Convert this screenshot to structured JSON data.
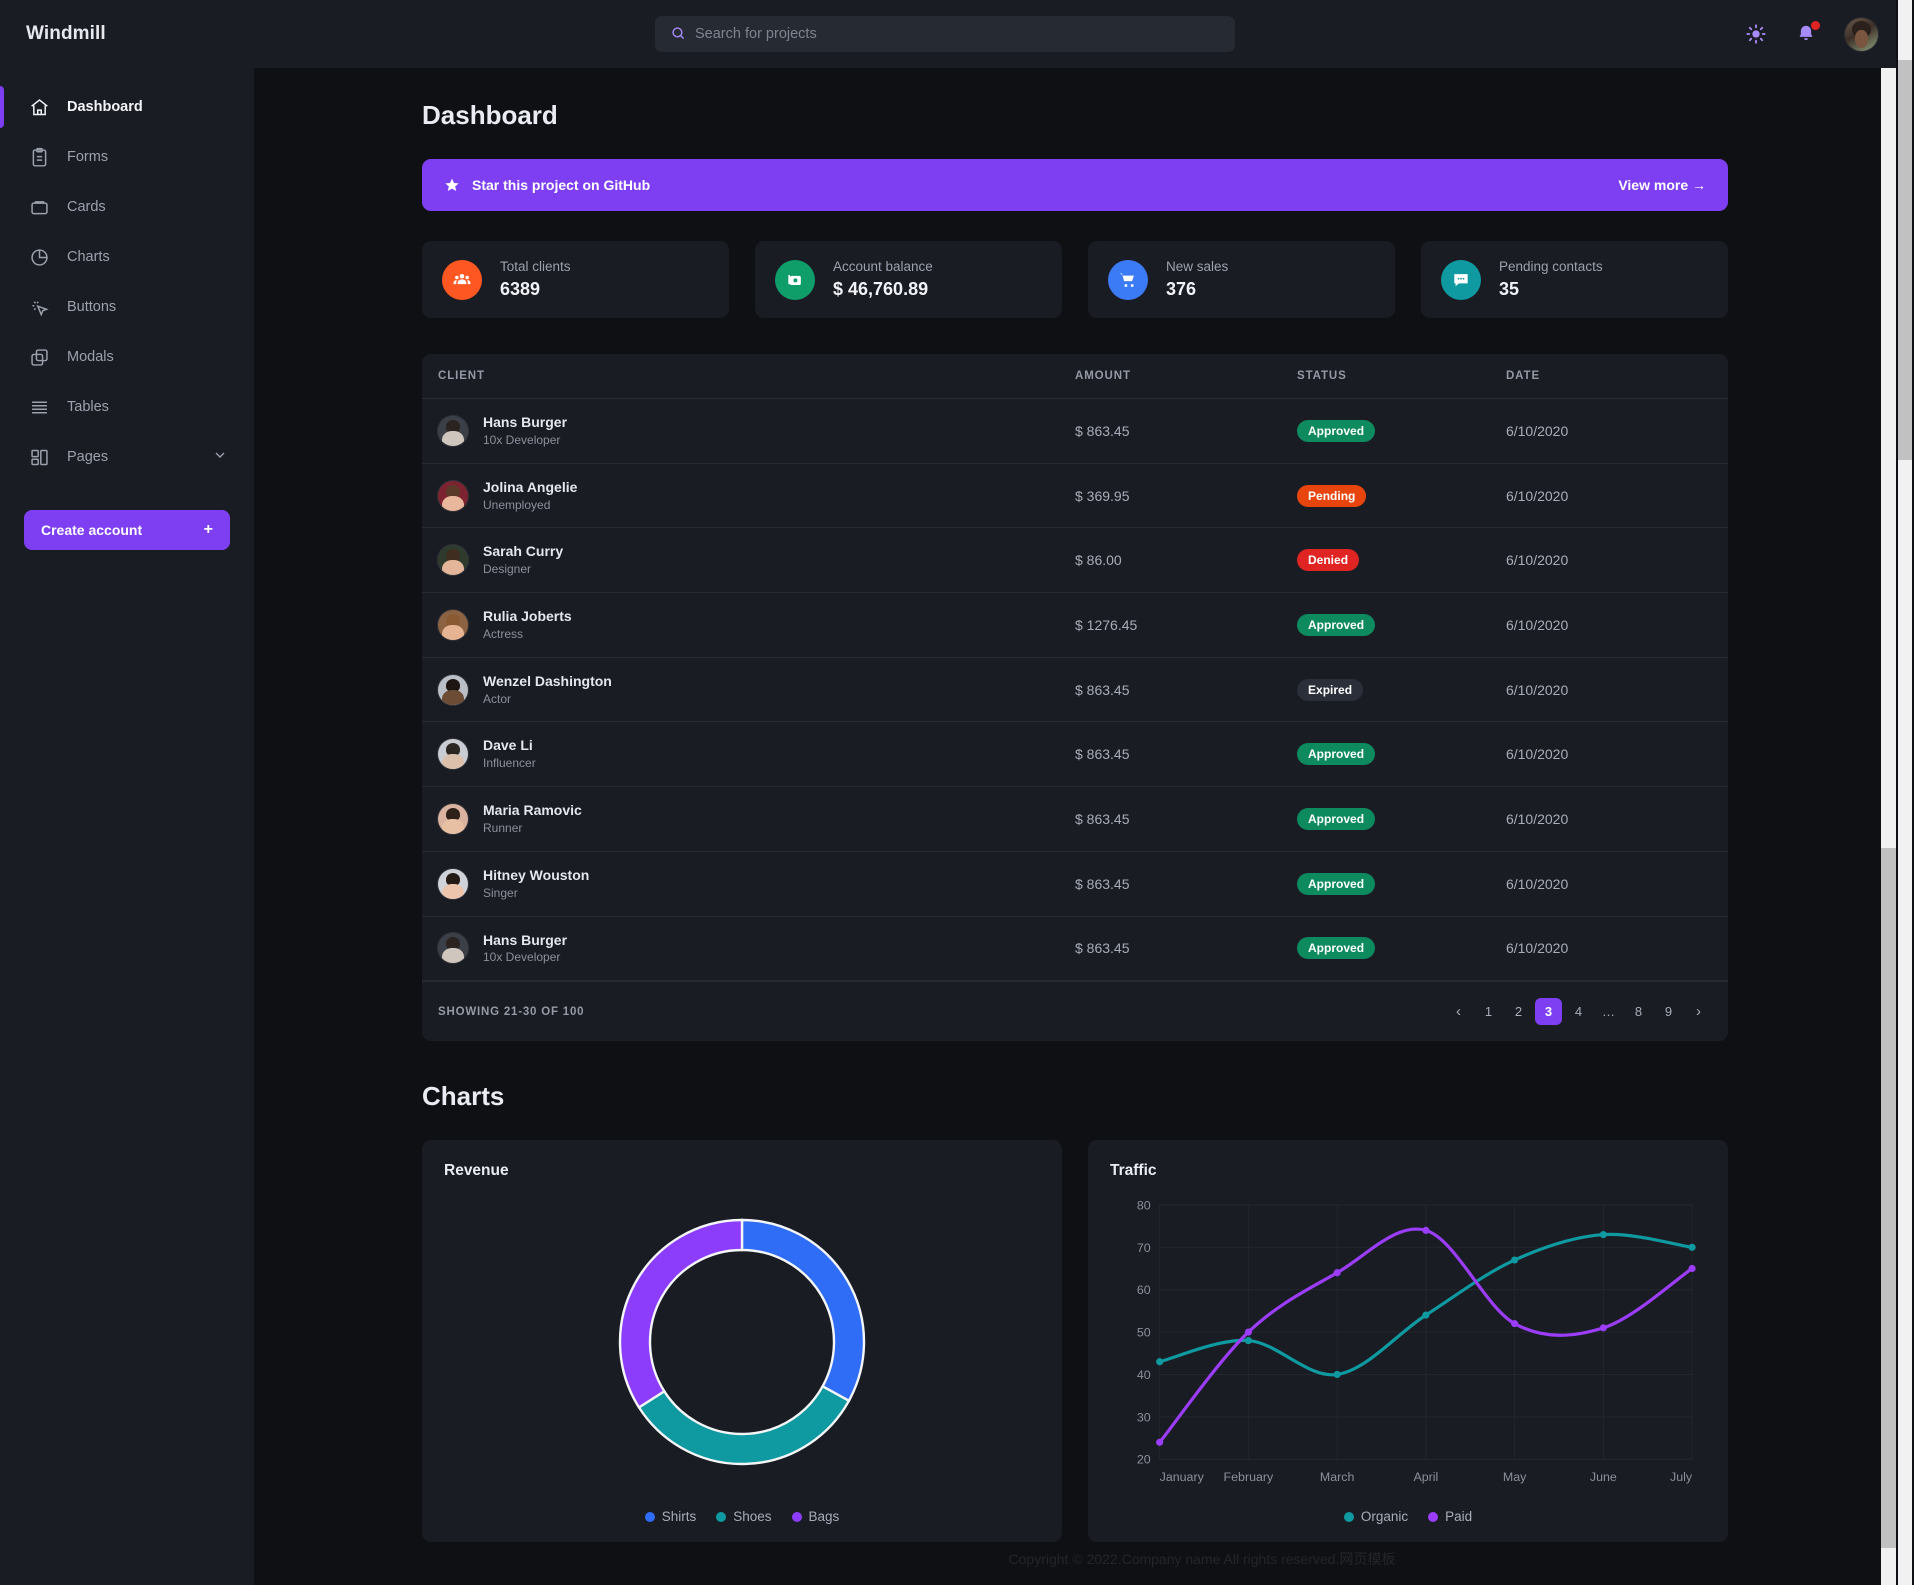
{
  "brand": "Windmill",
  "search": {
    "placeholder": "Search for projects"
  },
  "sidebar": {
    "items": [
      {
        "label": "Dashboard",
        "icon": "home-icon"
      },
      {
        "label": "Forms",
        "icon": "clipboard-icon"
      },
      {
        "label": "Cards",
        "icon": "card-icon"
      },
      {
        "label": "Charts",
        "icon": "pie-chart-icon"
      },
      {
        "label": "Buttons",
        "icon": "cursor-click-icon"
      },
      {
        "label": "Modals",
        "icon": "copy-icon"
      },
      {
        "label": "Tables",
        "icon": "list-icon"
      },
      {
        "label": "Pages",
        "icon": "layout-icon"
      }
    ],
    "cta": {
      "label": "Create account",
      "plus": "+"
    }
  },
  "page": {
    "title": "Dashboard",
    "charts_title": "Charts"
  },
  "banner": {
    "text": "Star this project on GitHub",
    "link": "View more →"
  },
  "stats": [
    {
      "label": "Total clients",
      "value": "6389",
      "color": "#ff5722",
      "icon": "people-icon"
    },
    {
      "label": "Account balance",
      "value": "$ 46,760.89",
      "color": "#0f9d6a",
      "icon": "money-icon"
    },
    {
      "label": "New sales",
      "value": "376",
      "color": "#3b7cf6",
      "icon": "cart-icon"
    },
    {
      "label": "Pending contacts",
      "value": "35",
      "color": "#0e9aa0",
      "icon": "chat-icon"
    }
  ],
  "table": {
    "columns": [
      "CLIENT",
      "AMOUNT",
      "STATUS",
      "DATE"
    ],
    "rows": [
      {
        "name": "Hans Burger",
        "role": "10x Developer",
        "amount": "$ 863.45",
        "status": "Approved",
        "status_key": "approved",
        "date": "6/10/2020",
        "skin": "#cfc6bd",
        "hair": "#2a2320",
        "shirt": "#3b3f47"
      },
      {
        "name": "Jolina Angelie",
        "role": "Unemployed",
        "amount": "$ 369.95",
        "status": "Pending",
        "status_key": "pending",
        "date": "6/10/2020",
        "skin": "#e8b79c",
        "hair": "#5b3a2a",
        "shirt": "#7d2230"
      },
      {
        "name": "Sarah Curry",
        "role": "Designer",
        "amount": "$ 86.00",
        "status": "Denied",
        "status_key": "denied",
        "date": "6/10/2020",
        "skin": "#e3b69a",
        "hair": "#3f2d20",
        "shirt": "#2e3b2c"
      },
      {
        "name": "Rulia Joberts",
        "role": "Actress",
        "amount": "$ 1276.45",
        "status": "Approved",
        "status_key": "approved",
        "date": "6/10/2020",
        "skin": "#e6b492",
        "hair": "#8a5a33",
        "shirt": "#8b6242"
      },
      {
        "name": "Wenzel Dashington",
        "role": "Actor",
        "amount": "$ 863.45",
        "status": "Expired",
        "status_key": "expired",
        "date": "6/10/2020",
        "skin": "#6d4c36",
        "hair": "#1d1512",
        "shirt": "#b9bec7"
      },
      {
        "name": "Dave Li",
        "role": "Influencer",
        "amount": "$ 863.45",
        "status": "Approved",
        "status_key": "approved",
        "date": "6/10/2020",
        "skin": "#dcc0ab",
        "hair": "#2b2622",
        "shirt": "#c9ccd2"
      },
      {
        "name": "Maria Ramovic",
        "role": "Runner",
        "amount": "$ 863.45",
        "status": "Approved",
        "status_key": "approved",
        "date": "6/10/2020",
        "skin": "#e7bfa2",
        "hair": "#2e211a",
        "shirt": "#d9b3a0"
      },
      {
        "name": "Hitney Wouston",
        "role": "Singer",
        "amount": "$ 863.45",
        "status": "Approved",
        "status_key": "approved",
        "date": "6/10/2020",
        "skin": "#edc5ad",
        "hair": "#241b16",
        "shirt": "#cfd3d9"
      },
      {
        "name": "Hans Burger",
        "role": "10x Developer",
        "amount": "$ 863.45",
        "status": "Approved",
        "status_key": "approved",
        "date": "6/10/2020",
        "skin": "#cfc6bd",
        "hair": "#2a2320",
        "shirt": "#3b3f47"
      }
    ],
    "showing": "SHOWING 21-30 OF 100",
    "pagination": {
      "prev": "‹",
      "next": "›",
      "pages": [
        "1",
        "2",
        "3",
        "4",
        "…",
        "8",
        "9"
      ],
      "active": "3"
    }
  },
  "chart_data": [
    {
      "type": "pie",
      "title": "Revenue",
      "labels": [
        "Shirts",
        "Shoes",
        "Bags"
      ],
      "values": [
        33,
        33,
        34
      ],
      "colors": [
        "#2f6df6",
        "#0e9aa0",
        "#8b3dfb"
      ],
      "donut": true,
      "legend_position": "bottom"
    },
    {
      "type": "line",
      "title": "Traffic",
      "categories": [
        "January",
        "February",
        "March",
        "April",
        "May",
        "June",
        "July"
      ],
      "series": [
        {
          "name": "Organic",
          "color": "#0e9aa0",
          "values": [
            43,
            48,
            40,
            54,
            67,
            73,
            70
          ]
        },
        {
          "name": "Paid",
          "color": "#9b3dfb",
          "values": [
            24,
            50,
            64,
            74,
            52,
            51,
            65
          ]
        }
      ],
      "ylim": [
        20,
        80
      ],
      "yticks": [
        20,
        30,
        40,
        50,
        60,
        70,
        80
      ],
      "xlabel": "",
      "ylabel": "",
      "grid": true,
      "legend_position": "bottom"
    }
  ],
  "footer": {
    "text": "Copyright © 2022.Company name All rights reserved.网页模板"
  }
}
